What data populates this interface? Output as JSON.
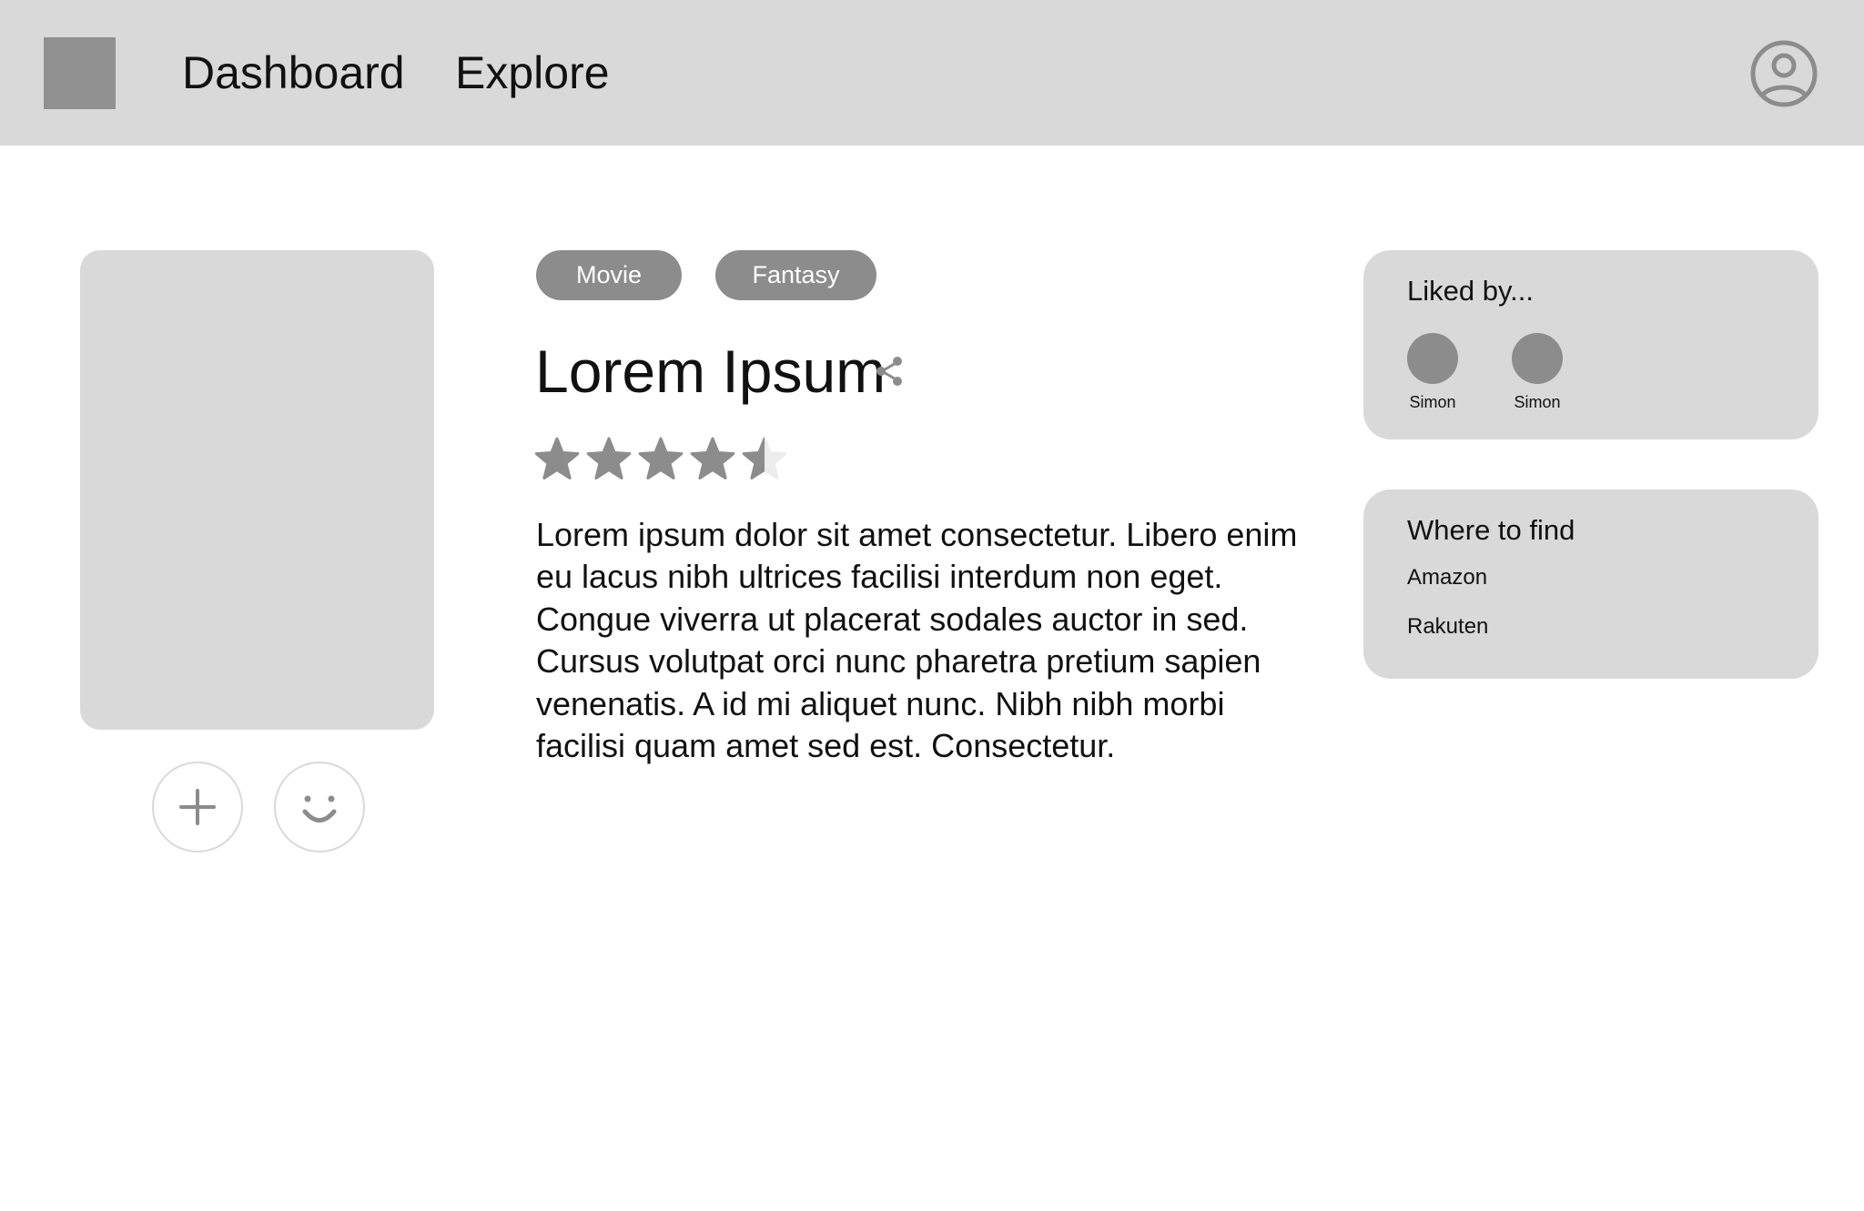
{
  "header": {
    "nav": [
      {
        "label": "Dashboard"
      },
      {
        "label": "Explore"
      }
    ],
    "account_icon": "user-circle-icon"
  },
  "media": {
    "tags": [
      {
        "label": "Movie"
      },
      {
        "label": "Fantasy"
      }
    ],
    "title": "Lorem Ipsum",
    "share_icon": "share-icon",
    "rating": {
      "value": 4.5,
      "max": 5
    },
    "description": "Lorem ipsum dolor sit amet consectetur. Libero enim eu lacus nibh ultrices facilisi interdum non eget. Congue viverra ut placerat sodales auctor in sed. Cursus volutpat orci nunc pharetra pretium sapien venenatis. A id mi aliquet nunc. Nibh nibh morbi facilisi quam amet sed est. Consectetur.",
    "actions": [
      {
        "icon": "plus-icon"
      },
      {
        "icon": "smiley-icon"
      }
    ]
  },
  "liked_by": {
    "heading": "Liked by...",
    "users": [
      {
        "name": "Simon"
      },
      {
        "name": "Simon"
      }
    ]
  },
  "where_to_find": {
    "heading": "Where to find",
    "stores": [
      {
        "label": "Amazon"
      },
      {
        "label": "Rakuten"
      }
    ]
  },
  "colors": {
    "header_bg": "#d9d9d9",
    "placeholder_gray": "#8c8c8c",
    "star_filled": "#8c8c8c",
    "star_empty": "#ececec"
  }
}
